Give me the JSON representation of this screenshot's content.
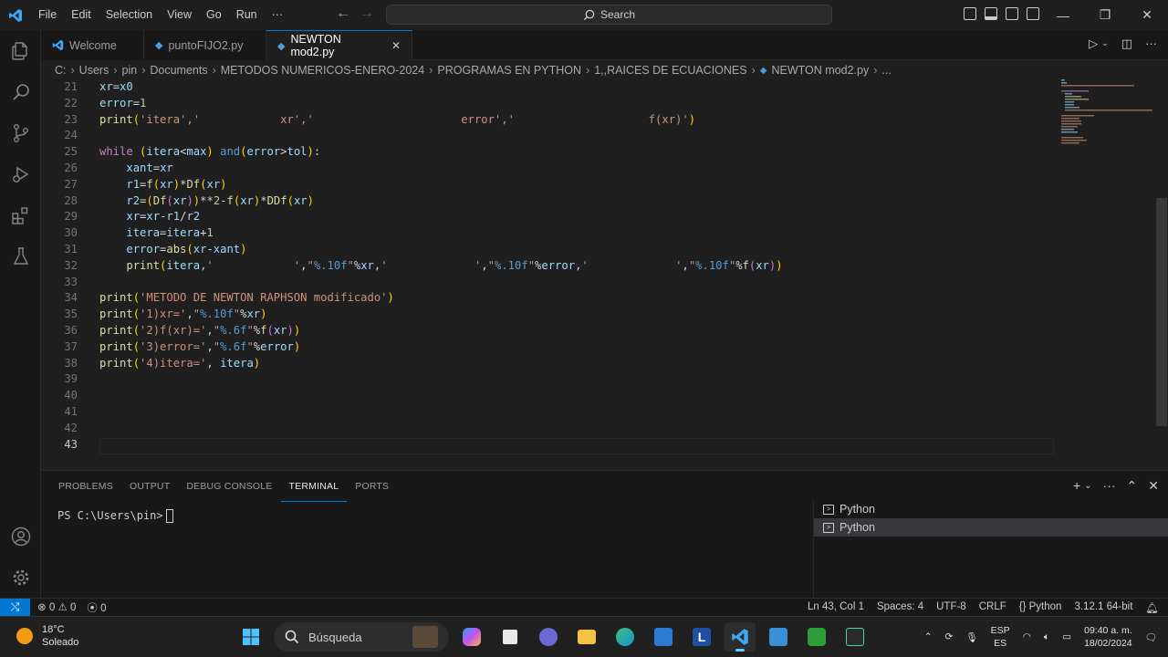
{
  "menu": [
    "File",
    "Edit",
    "Selection",
    "View",
    "Go",
    "Run",
    "···"
  ],
  "search": {
    "label": "Search"
  },
  "tabs": [
    {
      "label": "Welcome"
    },
    {
      "label": "puntoFIJO2.py"
    },
    {
      "label": "NEWTON mod2.py"
    }
  ],
  "breadcrumb": [
    "C:",
    "Users",
    "pin",
    "Documents",
    "METODOS NUMERICOS-ENERO-2024",
    "PROGRAMAS EN PYTHON",
    "1,,RAICES DE ECUACIONES",
    "NEWTON mod2.py",
    "..."
  ],
  "code": {
    "line_numbers": [
      "21",
      "22",
      "23",
      "24",
      "25",
      "26",
      "27",
      "28",
      "29",
      "30",
      "31",
      "32",
      "33",
      "34",
      "35",
      "36",
      "37",
      "38",
      "39",
      "40",
      "41",
      "42",
      "43"
    ],
    "current_line": "43"
  },
  "panel": {
    "tabs": [
      "PROBLEMS",
      "OUTPUT",
      "DEBUG CONSOLE",
      "TERMINAL",
      "PORTS"
    ],
    "active_tab": "TERMINAL",
    "prompt": "PS C:\\Users\\pin>",
    "terminals": [
      "Python",
      "Python"
    ]
  },
  "status": {
    "errors": "0",
    "warnings": "0",
    "ports": "0",
    "position": "Ln 43, Col 1",
    "spaces": "Spaces: 4",
    "encoding": "UTF-8",
    "eol": "CRLF",
    "language": "Python",
    "interpreter": "3.12.1 64-bit"
  },
  "taskbar": {
    "temp": "18°C",
    "weather": "Soleado",
    "search": "Búsqueda",
    "lang1": "ESP",
    "lang2": "ES",
    "time": "09:40 a. m.",
    "date": "18/02/2024"
  },
  "colors": {
    "accent": "#0078d4",
    "keyword": "#c586c0",
    "string": "#ce9178",
    "function": "#dcdcaa",
    "variable": "#9cdcfe"
  }
}
